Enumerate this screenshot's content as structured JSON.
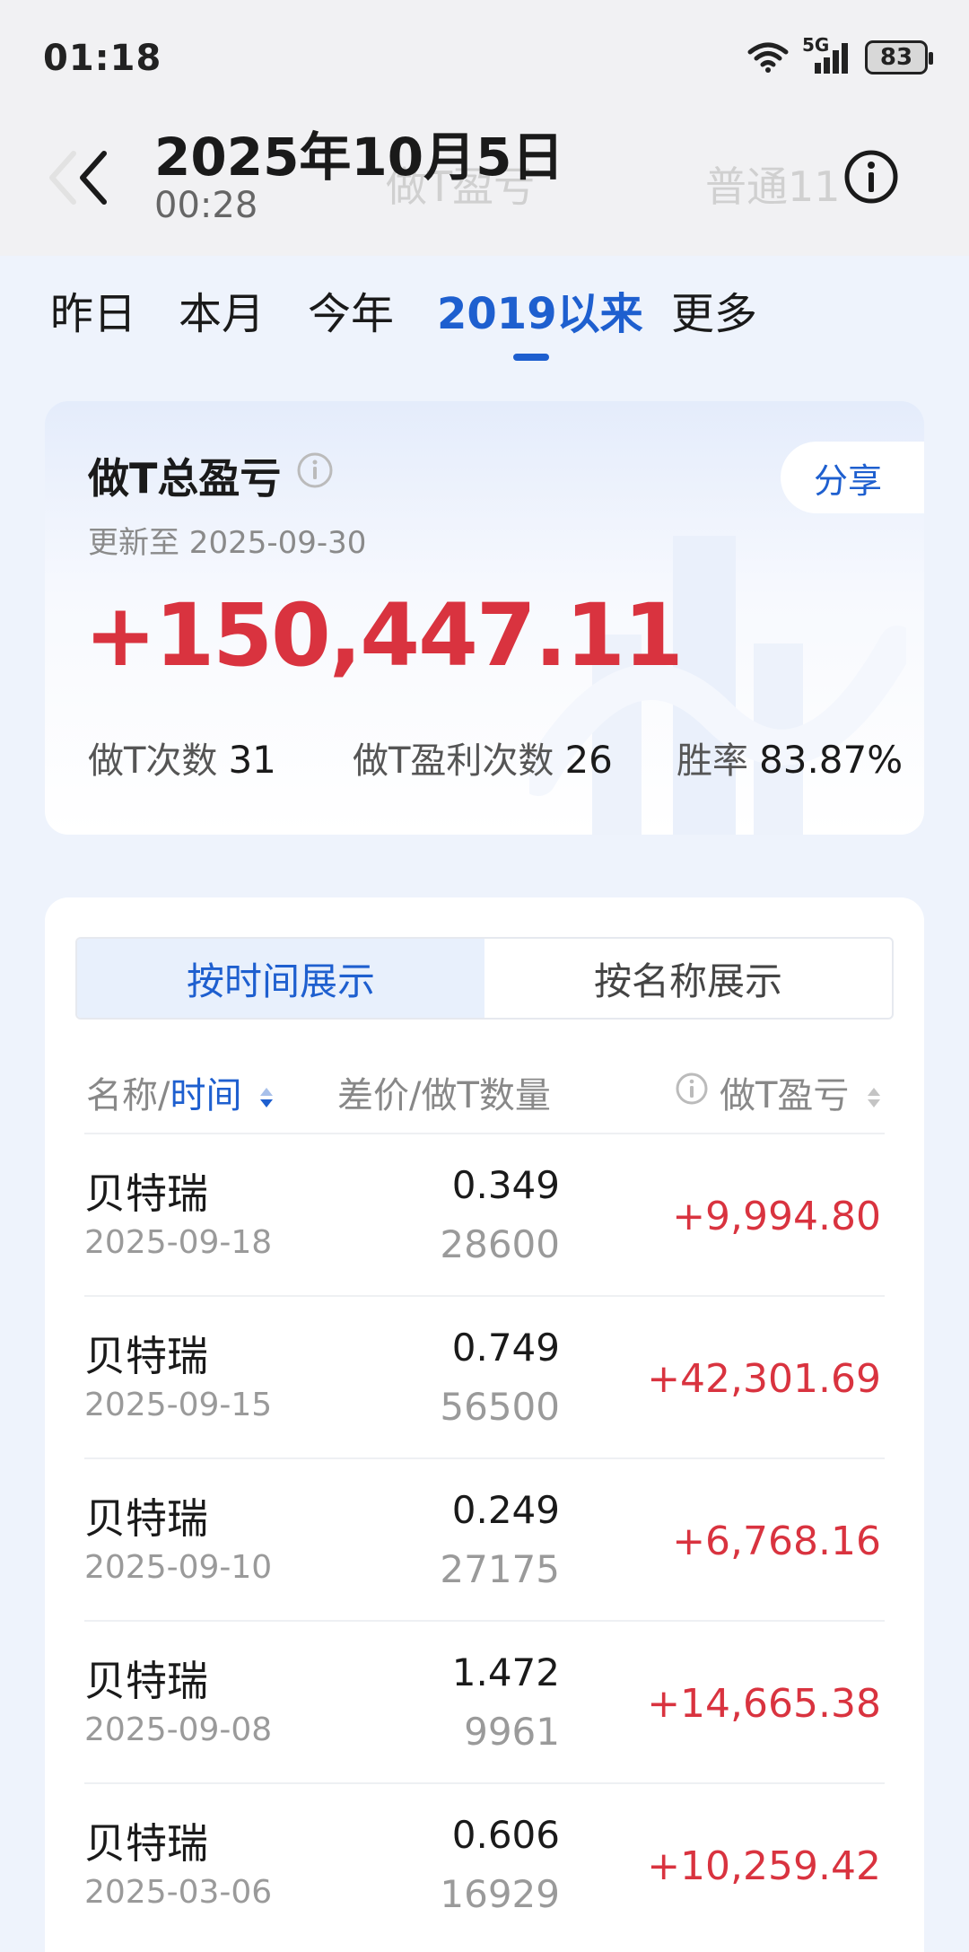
{
  "status_bar": {
    "time": "01:18",
    "network": "5G",
    "battery": "83"
  },
  "header": {
    "date_title": "2025年10月5日",
    "time_sub": "00:28",
    "ghost_title": "做T盈亏",
    "ghost_right": "普通11"
  },
  "tabs": [
    {
      "label": "昨日",
      "active": false
    },
    {
      "label": "本月",
      "active": false
    },
    {
      "label": "今年",
      "active": false
    },
    {
      "label": "2019以来",
      "active": true
    },
    {
      "label": "更多",
      "active": false
    }
  ],
  "summary": {
    "title": "做T总盈亏",
    "update_text": "更新至 2025-09-30",
    "share_label": "分享",
    "total": "+150,447.11",
    "stats": [
      {
        "label": "做T次数",
        "value": "31"
      },
      {
        "label": "做T盈利次数",
        "value": "26"
      },
      {
        "label": "胜率",
        "value": "83.87%"
      }
    ]
  },
  "list": {
    "segments": [
      {
        "label": "按时间展示",
        "active": true
      },
      {
        "label": "按名称展示",
        "active": false
      }
    ],
    "columns": {
      "name_prefix": "名称/",
      "name_sort": "时间",
      "diff_qty": "差价/做T数量",
      "pnl": "做T盈亏"
    },
    "rows": [
      {
        "name": "贝特瑞",
        "date": "2025-09-18",
        "diff": "0.349",
        "qty": "28600",
        "pnl": "+9,994.80"
      },
      {
        "name": "贝特瑞",
        "date": "2025-09-15",
        "diff": "0.749",
        "qty": "56500",
        "pnl": "+42,301.69"
      },
      {
        "name": "贝特瑞",
        "date": "2025-09-10",
        "diff": "0.249",
        "qty": "27175",
        "pnl": "+6,768.16"
      },
      {
        "name": "贝特瑞",
        "date": "2025-09-08",
        "diff": "1.472",
        "qty": "9961",
        "pnl": "+14,665.38"
      },
      {
        "name": "贝特瑞",
        "date": "2025-03-06",
        "diff": "0.606",
        "qty": "16929",
        "pnl": "+10,259.42"
      }
    ]
  },
  "colors": {
    "accent": "#1e5fcf",
    "profit": "#d9333f",
    "background": "#eef3fc"
  }
}
